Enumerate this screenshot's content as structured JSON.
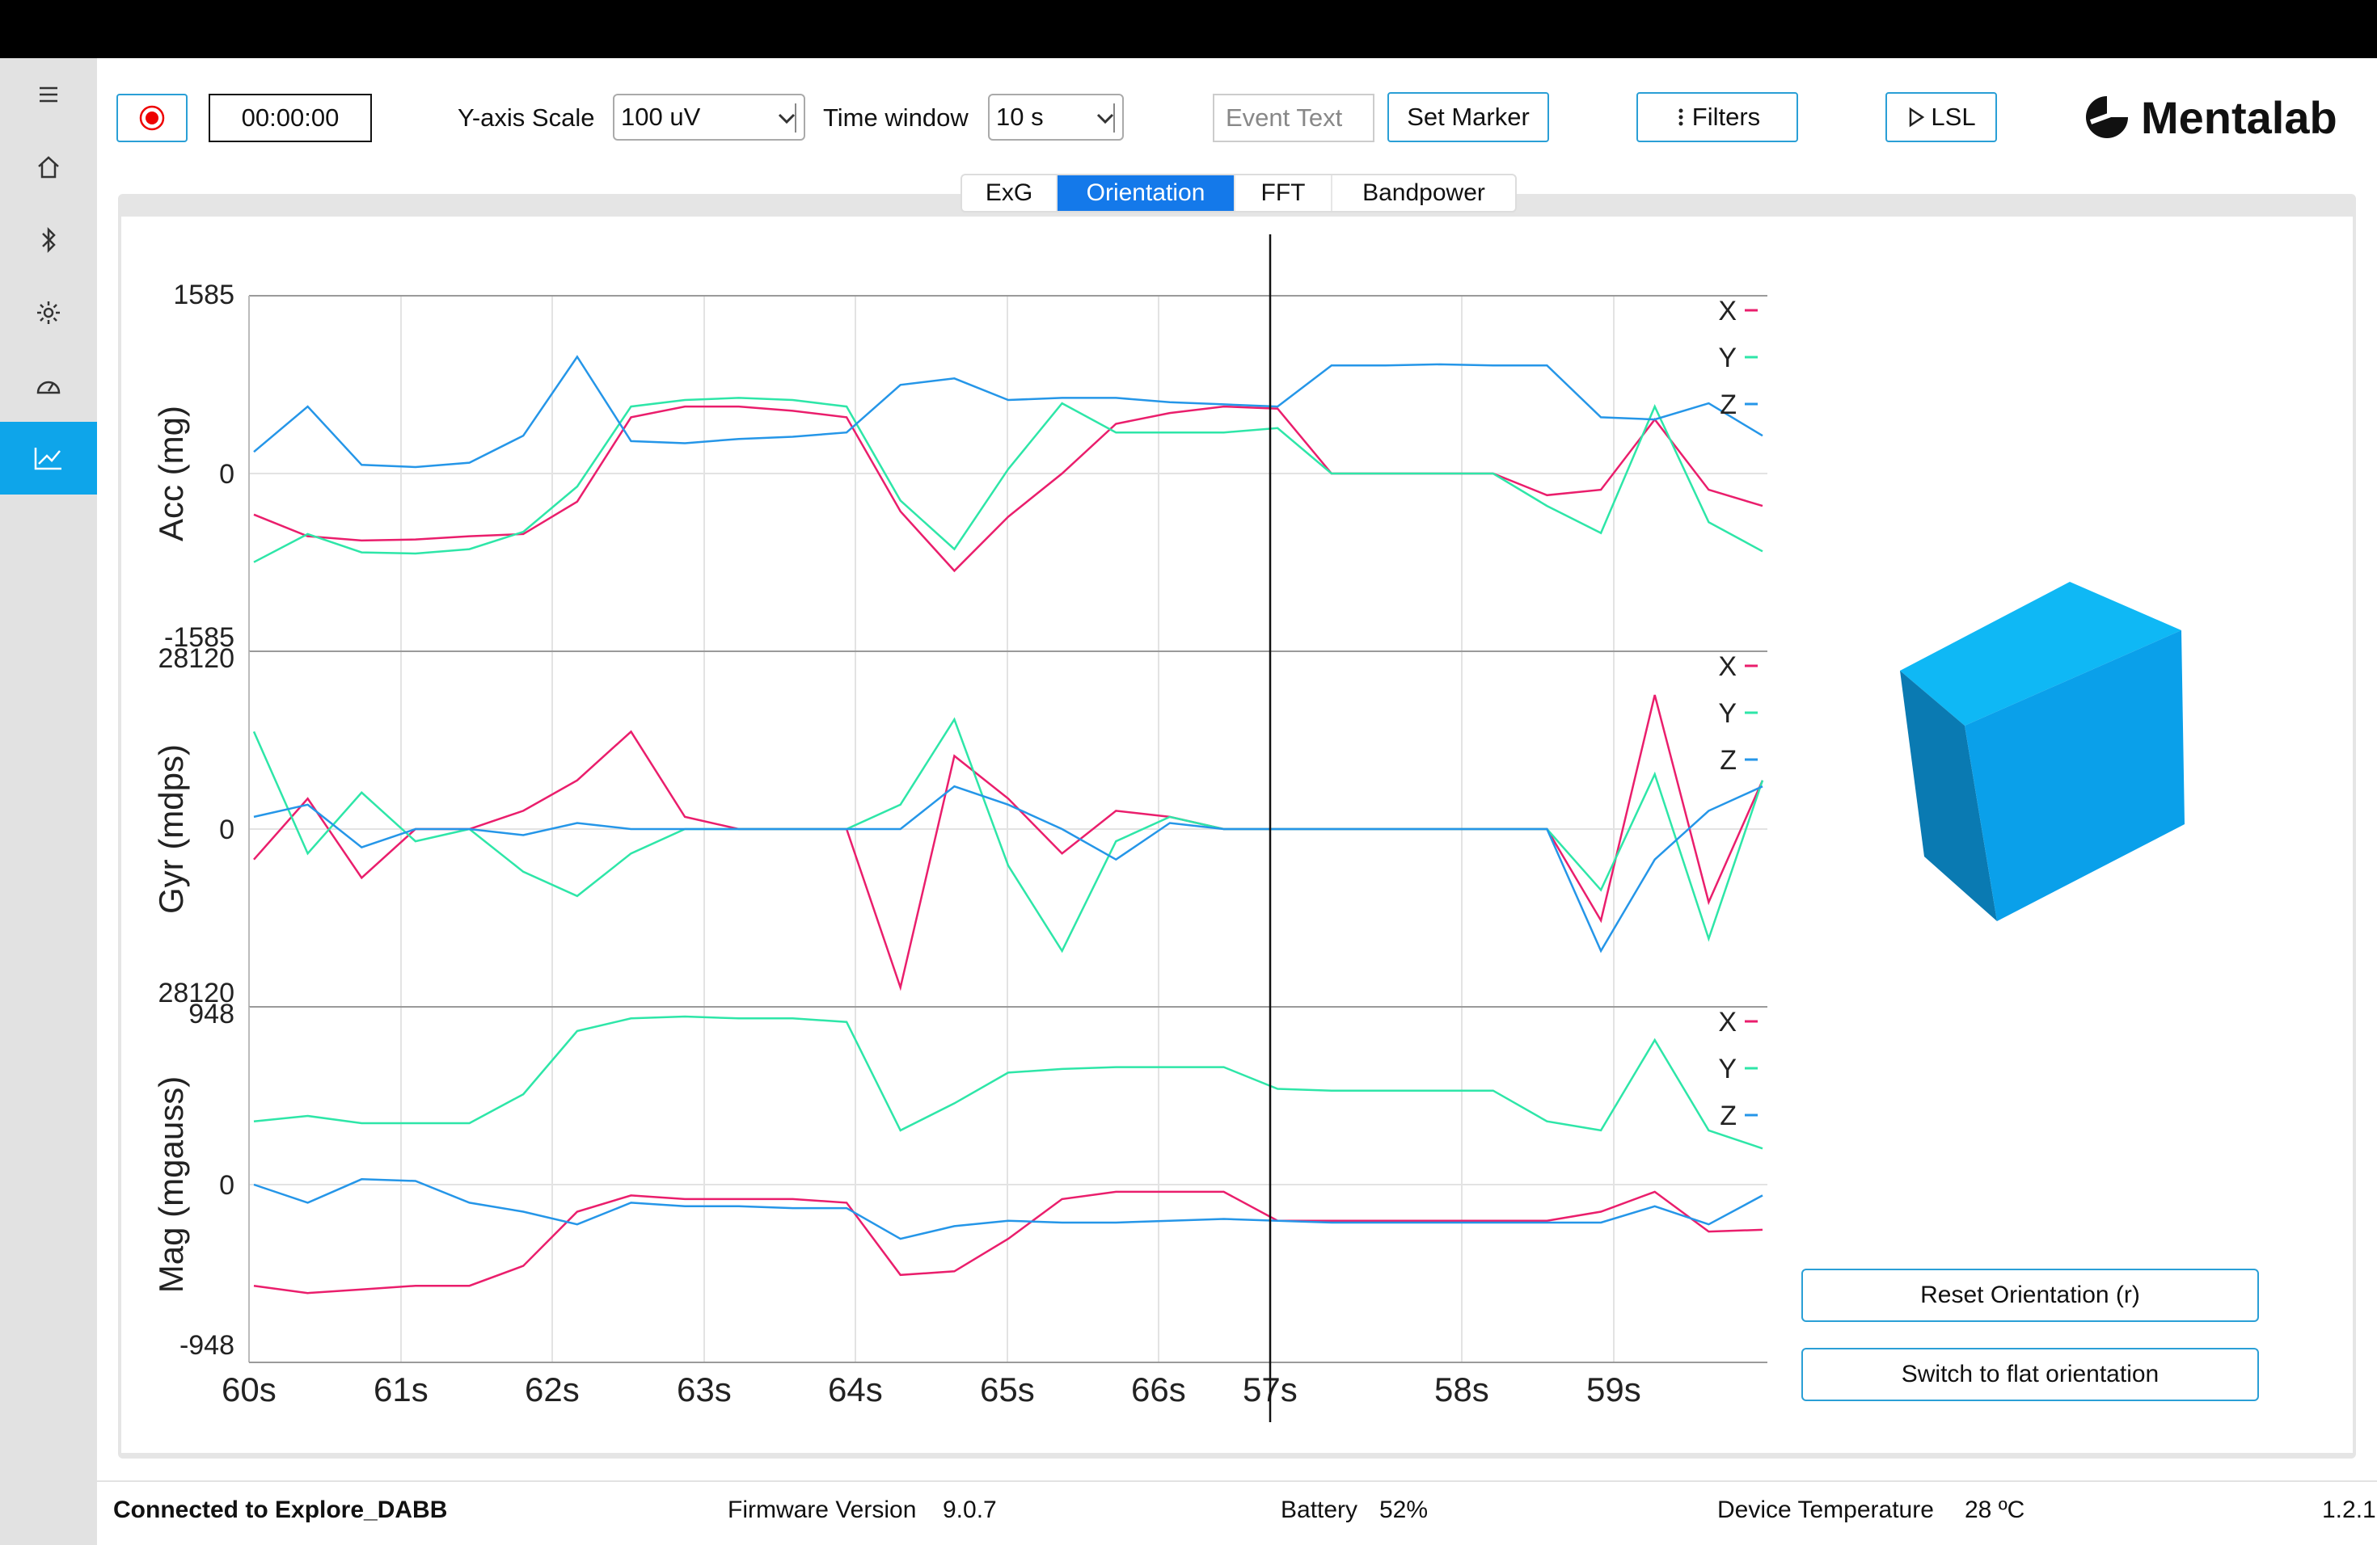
{
  "toolbar": {
    "timer": "00:00:00",
    "y_scale_label": "Y-axis Scale",
    "y_scale_value": "100 uV",
    "time_window_label": "Time window",
    "time_window_value": "10 s",
    "event_placeholder": "Event Text",
    "set_marker": "Set Marker",
    "filters": "Filters",
    "lsl": "LSL",
    "brand": "Mentalab"
  },
  "sidebar": {
    "items": [
      "menu-icon",
      "home-icon",
      "bluetooth-icon",
      "settings-icon",
      "gauge-icon",
      "chart-icon"
    ]
  },
  "tabs": [
    {
      "label": "ExG"
    },
    {
      "label": "Orientation"
    },
    {
      "label": "FFT"
    },
    {
      "label": "Bandpower"
    }
  ],
  "cube": {
    "reset": "Reset Orientation (r)",
    "flat": "Switch to flat orientation",
    "colors": {
      "top": "#0fb8f5",
      "front": "#0aa0ea",
      "side": "#0a7ab2"
    }
  },
  "status": {
    "connected": "Connected to Explore_DABB",
    "firmware_label": "Firmware Version",
    "firmware": "9.0.7",
    "battery_label": "Battery",
    "battery": "52%",
    "temp_label": "Device Temperature",
    "temp": "28 ºC",
    "version": "1.2.1"
  },
  "chart_data": {
    "type": "line",
    "x_tick_labels": [
      "60s",
      "61s",
      "62s",
      "63s",
      "64s",
      "65s",
      "66s",
      "57s",
      "58s",
      "59s"
    ],
    "series_colors": {
      "X": "#ea1e6c",
      "Y": "#2ee6a8",
      "Z": "#2596e8"
    },
    "grid": true,
    "panels": [
      {
        "ylabel": "Acc (mg)",
        "ticks": [
          "1585",
          "0",
          "-1585"
        ],
        "ylim": [
          -1585,
          1585
        ],
        "legend": [
          "X",
          "Y",
          "Z"
        ],
        "series": [
          {
            "name": "X",
            "values": [
              -380,
              -580,
              -620,
              -610,
              -580,
              -560,
              -260,
              520,
              620,
              620,
              580,
              520,
              -350,
              -900,
              -400,
              0,
              460,
              560,
              620,
              600,
              0,
              0,
              0,
              0,
              -200,
              -150,
              500,
              -150,
              -300
            ]
          },
          {
            "name": "Y",
            "values": [
              -820,
              -560,
              -730,
              -740,
              -700,
              -540,
              -120,
              620,
              680,
              700,
              680,
              620,
              -250,
              -700,
              40,
              650,
              380,
              380,
              380,
              420,
              0,
              0,
              0,
              0,
              -300,
              -550,
              620,
              -450,
              -720
            ]
          },
          {
            "name": "Z",
            "values": [
              200,
              620,
              80,
              60,
              100,
              350,
              1080,
              300,
              280,
              320,
              340,
              380,
              820,
              880,
              680,
              700,
              700,
              660,
              640,
              620,
              1000,
              1000,
              1010,
              1000,
              1000,
              520,
              500,
              650,
              350
            ]
          }
        ]
      },
      {
        "ylabel": "Gyr (mdps)",
        "ticks": [
          "28120",
          "0",
          "28120"
        ],
        "ylim": [
          -28120,
          28120
        ],
        "legend": [
          "X",
          "Y",
          "Z"
        ],
        "series": [
          {
            "name": "X",
            "values": [
              -5000,
              5000,
              -8000,
              0,
              0,
              3000,
              8000,
              16000,
              2000,
              0,
              0,
              0,
              -26000,
              12000,
              5000,
              -4000,
              3000,
              2000,
              0,
              0,
              0,
              0,
              0,
              0,
              0,
              -15000,
              22000,
              -12000,
              8000
            ]
          },
          {
            "name": "Y",
            "values": [
              16000,
              -4000,
              6000,
              -2000,
              0,
              -7000,
              -11000,
              -4000,
              0,
              0,
              0,
              0,
              4000,
              18000,
              -6000,
              -20000,
              -2000,
              2000,
              0,
              0,
              0,
              0,
              0,
              0,
              0,
              -10000,
              9000,
              -18000,
              8000
            ]
          },
          {
            "name": "Z",
            "values": [
              2000,
              4000,
              -3000,
              0,
              0,
              -1000,
              1000,
              0,
              0,
              0,
              0,
              0,
              0,
              7000,
              4000,
              0,
              -5000,
              1000,
              0,
              0,
              0,
              0,
              0,
              0,
              0,
              -20000,
              -5000,
              3000,
              7000
            ]
          }
        ]
      },
      {
        "ylabel": "Mag (mgauss)",
        "ticks": [
          "948",
          "0",
          "-948"
        ],
        "ylim": [
          -948,
          948
        ],
        "legend": [
          "X",
          "Y",
          "Z"
        ],
        "series": [
          {
            "name": "X",
            "values": [
              -560,
              -600,
              -580,
              -560,
              -560,
              -450,
              -150,
              -60,
              -80,
              -80,
              -80,
              -100,
              -500,
              -480,
              -300,
              -80,
              -40,
              -40,
              -40,
              -200,
              -200,
              -200,
              -200,
              -200,
              -200,
              -150,
              -40,
              -260,
              -250
            ]
          },
          {
            "name": "Y",
            "values": [
              350,
              380,
              340,
              340,
              340,
              500,
              850,
              920,
              930,
              920,
              920,
              900,
              300,
              450,
              620,
              640,
              650,
              650,
              650,
              530,
              520,
              520,
              520,
              520,
              350,
              300,
              800,
              300,
              200
            ]
          },
          {
            "name": "Z",
            "values": [
              0,
              -100,
              30,
              20,
              -100,
              -150,
              -220,
              -100,
              -120,
              -120,
              -130,
              -130,
              -300,
              -230,
              -200,
              -210,
              -210,
              -200,
              -190,
              -200,
              -210,
              -210,
              -210,
              -210,
              -210,
              -210,
              -120,
              -220,
              -60
            ]
          }
        ]
      }
    ]
  }
}
